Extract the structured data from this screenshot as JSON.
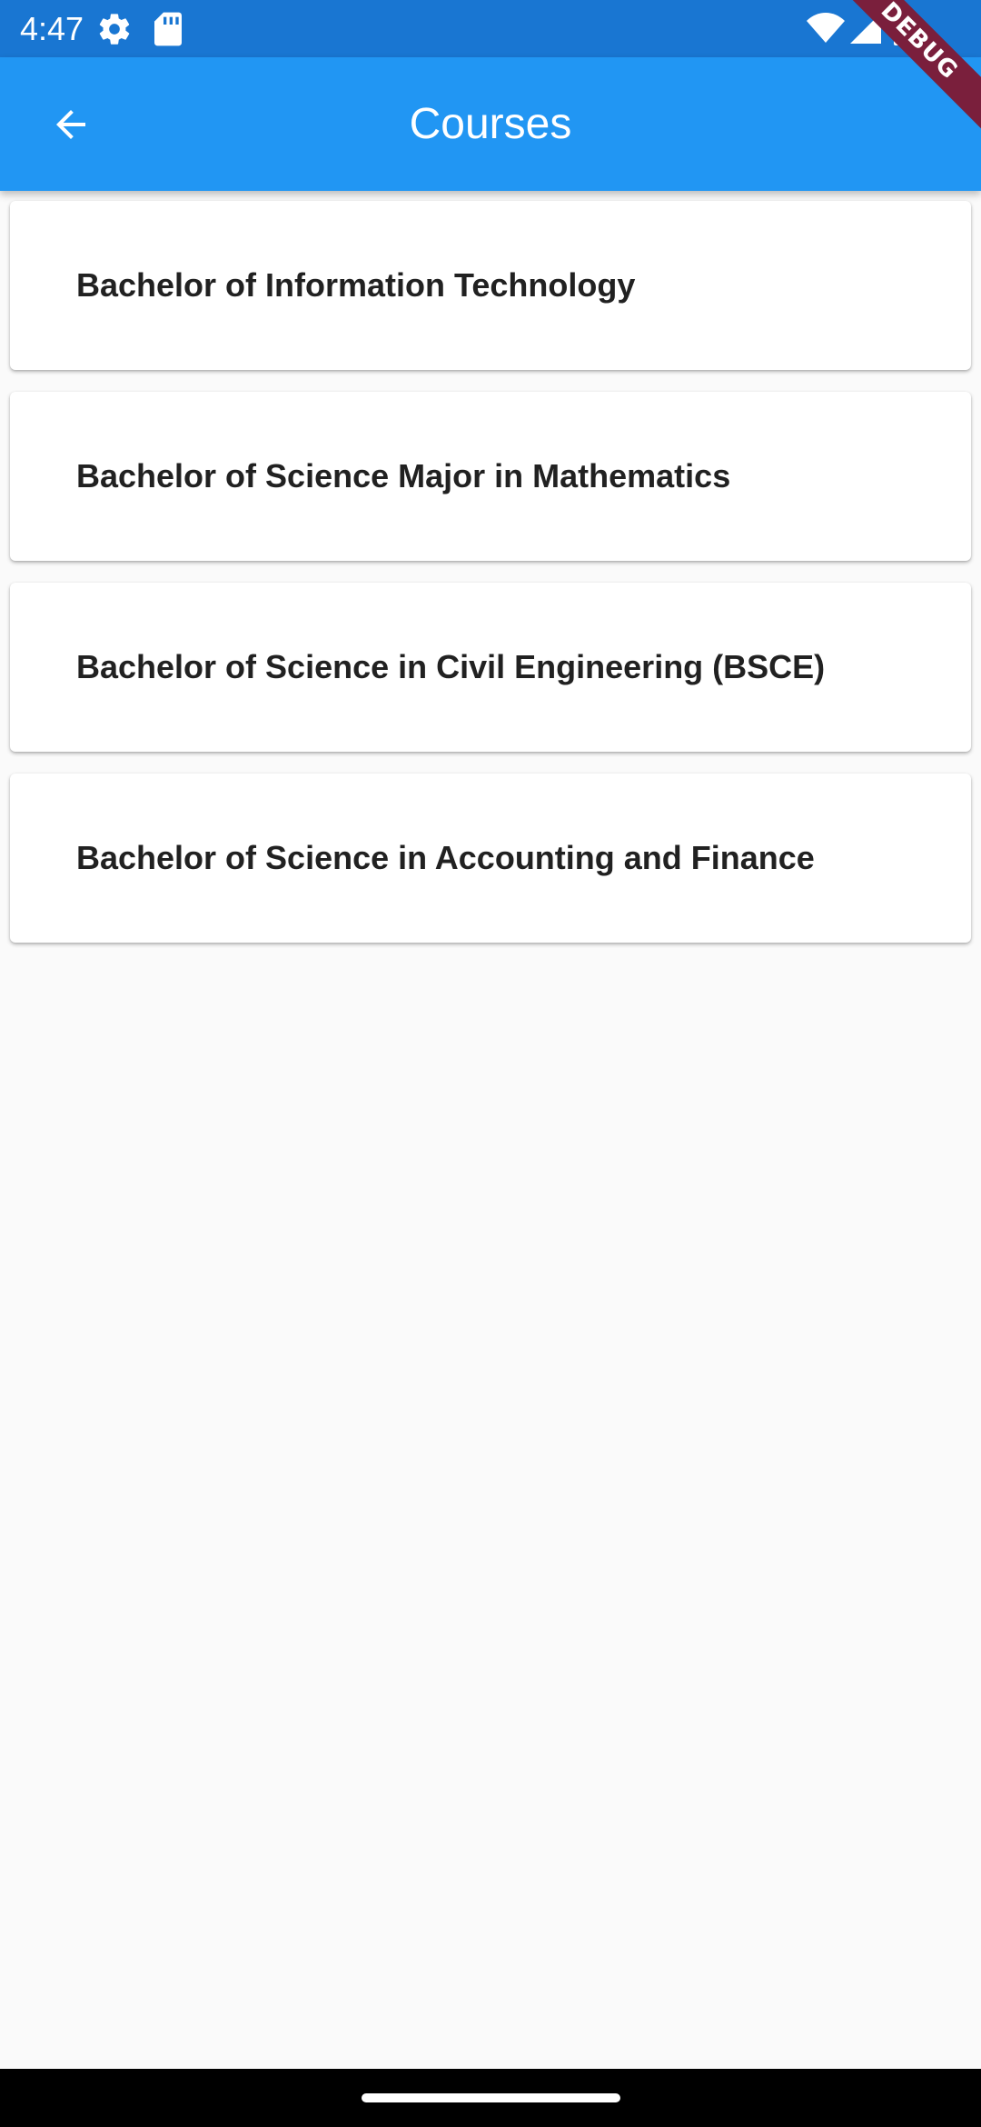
{
  "status_bar": {
    "time": "4:47",
    "icons": [
      "settings-gear-icon",
      "sd-card-icon",
      "wifi-icon",
      "signal-icon",
      "battery-icon"
    ]
  },
  "app_bar": {
    "title": "Courses",
    "back_icon": "arrow-back-icon",
    "background_color": "#2196f3"
  },
  "debug_banner": {
    "label": "DEBUG"
  },
  "courses": [
    {
      "title": "Bachelor of Information Technology"
    },
    {
      "title": "Bachelor of Science Major in Mathematics"
    },
    {
      "title": "Bachelor of Science in Civil Engineering (BSCE)"
    },
    {
      "title": "Bachelor of Science in Accounting and Finance"
    }
  ],
  "colors": {
    "status_bar": "#1976d2",
    "app_bar": "#2196f3",
    "background": "#fafafa",
    "card": "#ffffff",
    "text": "#212121"
  }
}
